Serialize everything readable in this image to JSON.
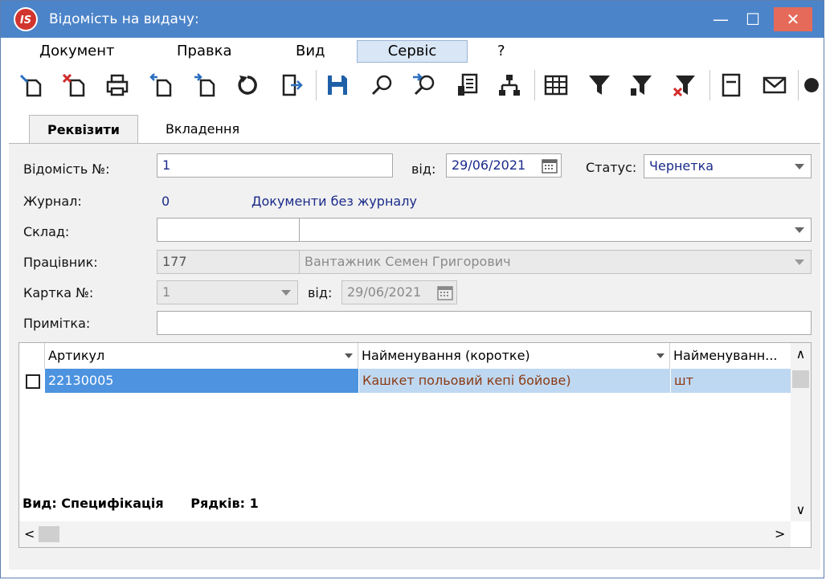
{
  "window": {
    "logo_text": "IS",
    "title": "Відомість на видачу:",
    "minimize": "—",
    "maximize": "☐",
    "close": "✕"
  },
  "menu": [
    "Документ",
    "Правка",
    "Вид",
    "Сервіс",
    "?"
  ],
  "menu_active": "Сервіс",
  "tabs": [
    "Реквізити",
    "Вкладення"
  ],
  "form": {
    "number_label": "Відомість №:",
    "number_value": "1",
    "date_label": "від:",
    "date_value": "29/06/2021",
    "status_label": "Статус:",
    "status_value": "Чернетка",
    "journal_label": "Журнал:",
    "journal_value": "0",
    "journal_link": "Документи без журналу",
    "warehouse_label": "Склад:",
    "warehouse_code": "",
    "warehouse_name": "",
    "employee_label": "Працівник:",
    "employee_code": "177",
    "employee_name": "Вантажник Семен Григорович",
    "card_label": "Картка №:",
    "card_value": "1",
    "card_date_label": "від:",
    "card_date_value": "29/06/2021",
    "note_label": "Примітка:",
    "note_value": ""
  },
  "grid": {
    "columns": [
      "Артикул",
      "Найменування (коротке)",
      "Найменуванн..."
    ],
    "rows": [
      {
        "article": "22130005",
        "name": "Кашкет польовий кепі бойове)",
        "unit": "шт"
      }
    ],
    "footer_view": "Вид: Специфікація",
    "footer_rows": "Рядків: 1",
    "scroll_up": "∧",
    "scroll_down": "∨",
    "scroll_left": "<",
    "scroll_right": ">"
  },
  "colors": {
    "titlebar": "#4c84c9",
    "close": "#e56a5a",
    "selected_row": "#bfd8f2",
    "link": "#1a2a8a"
  }
}
